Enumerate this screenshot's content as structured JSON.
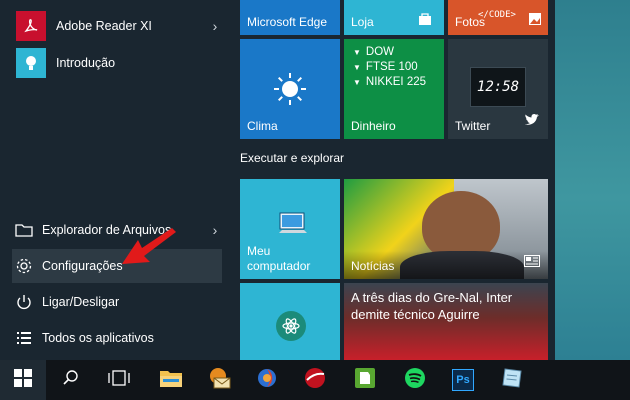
{
  "apps": [
    {
      "label": "Adobe Reader XI",
      "icon": "adobe-reader-icon",
      "has_submenu": true
    },
    {
      "label": "Introdução",
      "icon": "lightbulb-icon",
      "has_submenu": false
    }
  ],
  "system": {
    "explorer": {
      "label": "Explorador de Arquivos",
      "icon": "folder-icon",
      "has_submenu": true
    },
    "settings": {
      "label": "Configurações",
      "icon": "gear-icon",
      "highlighted": true
    },
    "power": {
      "label": "Ligar/Desligar",
      "icon": "power-icon"
    },
    "all_apps": {
      "label": "Todos os aplicativos",
      "icon": "list-icon"
    }
  },
  "tiles": {
    "edge": {
      "label": "Microsoft Edge",
      "color": "#1a78c8"
    },
    "store": {
      "label": "Loja",
      "color": "#2eb5d3"
    },
    "photos": {
      "label": "Fotos",
      "color": "#d8552a",
      "overlay": "</CODE>"
    },
    "weather": {
      "label": "Clima",
      "color": "#1a78c8"
    },
    "money": {
      "label": "Dinheiro",
      "color": "#0d8f45",
      "rows": [
        {
          "dir": "down",
          "text": "DOW"
        },
        {
          "dir": "down",
          "text": "FTSE 100"
        },
        {
          "dir": "down",
          "text": "NIKKEI 225"
        }
      ]
    },
    "twitter": {
      "label": "Twitter",
      "color": "#2a3740",
      "time": "12:58"
    },
    "my_computer": {
      "label_line1": "Meu",
      "label_line2": "computador",
      "color": "#2eb5d3"
    },
    "news": {
      "label": "Notícias"
    },
    "app_tile": {
      "color": "#2eb5d3"
    },
    "sports": {
      "headline": "A três dias do Gre-Nal, Inter demite técnico Aguirre"
    }
  },
  "group_title": "Executar e explorar",
  "colors": {
    "accent": "#2eb5d3",
    "background": "#1a2630",
    "taskbar": "#101418",
    "arrow": "#e11a1a"
  },
  "taskbar": {
    "items": [
      {
        "name": "start-button",
        "icon": "windows-logo-icon"
      },
      {
        "name": "search-button",
        "icon": "search-icon"
      },
      {
        "name": "task-view-button",
        "icon": "task-view-icon"
      },
      {
        "name": "file-explorer-app",
        "icon": "folder-icon"
      },
      {
        "name": "mail-app",
        "icon": "mail-icon"
      },
      {
        "name": "browser-app",
        "icon": "browser-icon"
      },
      {
        "name": "red-app",
        "icon": "red-globe-icon"
      },
      {
        "name": "evernote-app",
        "icon": "evernote-icon"
      },
      {
        "name": "spotify-app",
        "icon": "spotify-icon"
      },
      {
        "name": "photoshop-app",
        "icon": "photoshop-icon",
        "text": "Ps"
      },
      {
        "name": "notes-app",
        "icon": "note-icon"
      }
    ]
  }
}
